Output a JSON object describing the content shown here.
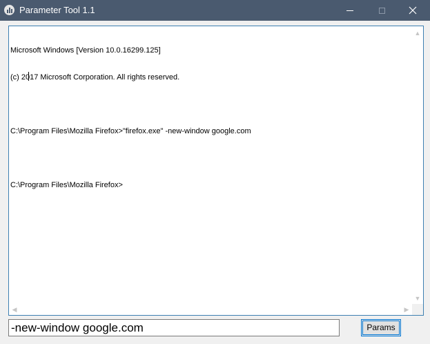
{
  "window": {
    "title": "Parameter Tool 1.1",
    "icon": "app-equalizer-icon",
    "controls": {
      "minimize": "minimize-icon",
      "maximize": "maximize-icon",
      "close": "close-icon"
    }
  },
  "console": {
    "lines": [
      "Microsoft Windows [Version 10.0.16299.125]",
      "(c) 2017 Microsoft Corporation. All rights reserved.",
      "",
      "C:\\Program Files\\Mozilla Firefox>\"firefox.exe\" -new-window google.com",
      "",
      "C:\\Program Files\\Mozilla Firefox>"
    ],
    "scroll_up": "▲",
    "scroll_down": "▼",
    "scroll_left": "◀",
    "scroll_right": "▶"
  },
  "params_input": {
    "value": "-new-window google.com"
  },
  "params_button": {
    "label": "Params"
  },
  "colors": {
    "titlebar": "#4a5a6f",
    "console_border": "#3c7fb1",
    "button_focus": "#0078d7"
  }
}
